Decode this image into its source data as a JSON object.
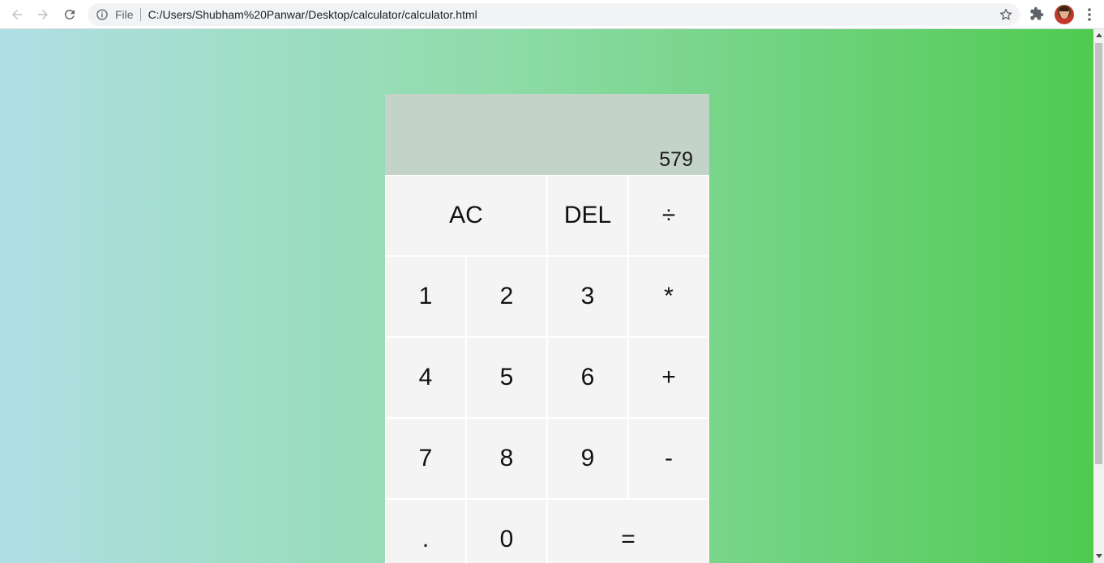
{
  "browser": {
    "file_label": "File",
    "url": "C:/Users/Shubham%20Panwar/Desktop/calculator/calculator.html"
  },
  "calculator": {
    "previous_operand": "",
    "current_operand": "579",
    "buttons": {
      "ac": "AC",
      "del": "DEL",
      "divide": "÷",
      "one": "1",
      "two": "2",
      "three": "3",
      "multiply": "*",
      "four": "4",
      "five": "5",
      "six": "6",
      "plus": "+",
      "seven": "7",
      "eight": "8",
      "nine": "9",
      "minus": "-",
      "dot": ".",
      "zero": "0",
      "equals": "="
    }
  },
  "colors": {
    "gradient_left": "#b0dfe5",
    "gradient_right": "#4fcb50",
    "output_bg": "#c4d3c8",
    "button_bg": "#f4f4f4"
  }
}
